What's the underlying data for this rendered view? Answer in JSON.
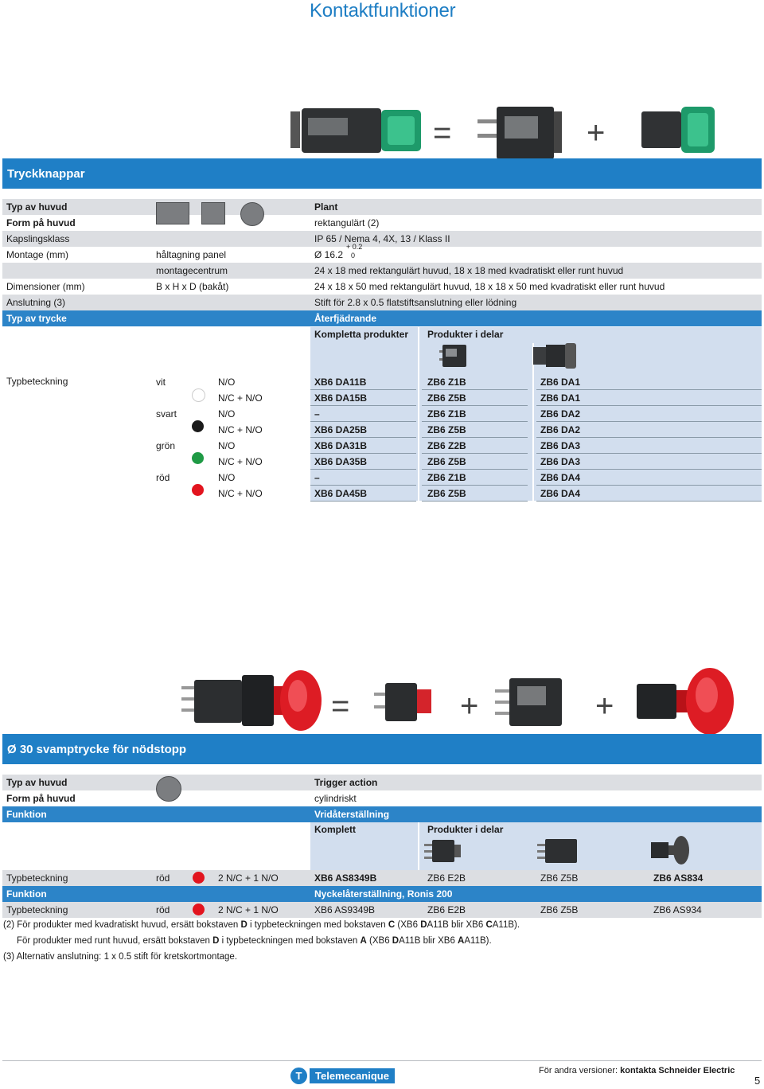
{
  "page_title": "Kontaktfunktioner",
  "symbols": {
    "equals": "=",
    "plus": "+"
  },
  "section1": {
    "banner": "Tryckknappar",
    "rows": {
      "typ_av_huvud": {
        "label": "Typ av huvud",
        "value": "Plant"
      },
      "form_pa_huvud": {
        "label": "Form på huvud",
        "value": "rektangulärt (2)"
      },
      "kapslingsklass": {
        "label": "Kapslingsklass",
        "value": "IP 65 / Nema 4, 4X, 13 / Klass II"
      },
      "montage": {
        "label": "Montage (mm)",
        "sub": "håltagning panel",
        "value": "Ø 16.2",
        "tol_upper": "+ 0.2",
        "tol_lower": "0"
      },
      "montagecentrum": {
        "sub": "montagecentrum",
        "value": "24 x 18 med rektangulärt huvud, 18 x 18 med kvadratiskt eller runt huvud"
      },
      "dimensioner": {
        "label": "Dimensioner (mm)",
        "sub": "B x H x D (bakåt)",
        "value": "24 x 18 x 50 med rektangulärt huvud, 18 x 18 x 50 med kvadratiskt eller runt huvud"
      },
      "anslutning": {
        "label": "Anslutning (3)",
        "value": "Stift för 2.8 x 0.5 flatstiftsanslutning eller lödning"
      },
      "typ_av_trycke": {
        "label": "Typ av trycke",
        "value": "Återfjädrande"
      }
    },
    "col_headers": {
      "complete": "Kompletta produkter",
      "parts": "Produkter i delar"
    },
    "typbeteckning_label": "Typbeteckning",
    "products": [
      {
        "color_name": "vit",
        "color": "#ffffff",
        "contact": "N/O",
        "complete": "XB6 DA11B",
        "part1": "ZB6 Z1B",
        "part2": "ZB6 DA1"
      },
      {
        "color_name": "",
        "color": "",
        "contact": "N/C + N/O",
        "complete": "XB6 DA15B",
        "part1": "ZB6 Z5B",
        "part2": "ZB6 DA1"
      },
      {
        "color_name": "svart",
        "color": "#1a1a1a",
        "contact": "N/O",
        "complete": "–",
        "part1": "ZB6 Z1B",
        "part2": "ZB6 DA2"
      },
      {
        "color_name": "",
        "color": "",
        "contact": "N/C + N/O",
        "complete": "XB6 DA25B",
        "part1": "ZB6 Z5B",
        "part2": "ZB6 DA2"
      },
      {
        "color_name": "grön",
        "color": "#1f9a45",
        "contact": "N/O",
        "complete": "XB6 DA31B",
        "part1": "ZB6 Z2B",
        "part2": "ZB6 DA3"
      },
      {
        "color_name": "",
        "color": "",
        "contact": "N/C + N/O",
        "complete": "XB6 DA35B",
        "part1": "ZB6 Z5B",
        "part2": "ZB6 DA3"
      },
      {
        "color_name": "röd",
        "color": "#e2141e",
        "contact": "N/O",
        "complete": "–",
        "part1": "ZB6 Z1B",
        "part2": "ZB6 DA4"
      },
      {
        "color_name": "",
        "color": "",
        "contact": "N/C + N/O",
        "complete": "XB6 DA45B",
        "part1": "ZB6 Z5B",
        "part2": "ZB6 DA4"
      }
    ]
  },
  "section2": {
    "banner": "Ø 30 svamptrycke för nödstopp",
    "rows": {
      "typ_av_huvud": {
        "label": "Typ av huvud",
        "value": "Trigger action"
      },
      "form_pa_huvud": {
        "label": "Form på huvud",
        "value": "cylindriskt"
      },
      "funktion": {
        "label": "Funktion",
        "value": "Vridåterställning"
      }
    },
    "col_headers": {
      "complete": "Komplett",
      "parts": "Produkter i delar"
    },
    "product1": {
      "label": "Typbeteckning",
      "color_name": "röd",
      "contact": "2 N/C + 1 N/O",
      "complete": "XB6 AS8349B",
      "part1": "ZB6 E2B",
      "part2": "ZB6 Z5B",
      "part3": "ZB6 AS834"
    },
    "funktion2": {
      "label": "Funktion",
      "value": "Nyckelåterställning, Ronis 200"
    },
    "product2": {
      "label": "Typbeteckning",
      "color_name": "röd",
      "contact": "2 N/C + 1 N/O",
      "complete": "XB6 AS9349B",
      "part1": "ZB6 E2B",
      "part2": "ZB6 Z5B",
      "part3": "ZB6 AS934"
    }
  },
  "footnotes": {
    "n2a": {
      "prefix": "(2) För produkter med kvadratiskt huvud, ersätt bokstaven ",
      "b1": "D",
      "mid1": " i typbeteckningen med bokstaven ",
      "b2": "C",
      "mid2": " (XB6 ",
      "b3": "D",
      "mid3": "A11B blir XB6 ",
      "b4": "C",
      "end": "A11B)."
    },
    "n2b": {
      "prefix": "För produkter med runt huvud, ersätt bokstaven ",
      "b1": "D",
      "mid1": " i typbeteckningen med bokstaven ",
      "b2": "A",
      "mid2": " (XB6 ",
      "b3": "D",
      "mid3": "A11B blir XB6 ",
      "b4": "A",
      "end": "A11B)."
    },
    "n3": "(3) Alternativ anslutning: 1 x 0.5 stift för kretskortmontage."
  },
  "footer": {
    "brand": "Telemecanique",
    "logo_mark": "T",
    "note_prefix": "För andra versioner: ",
    "note_bold": "kontakta Schneider Electric",
    "page_number": "5"
  }
}
